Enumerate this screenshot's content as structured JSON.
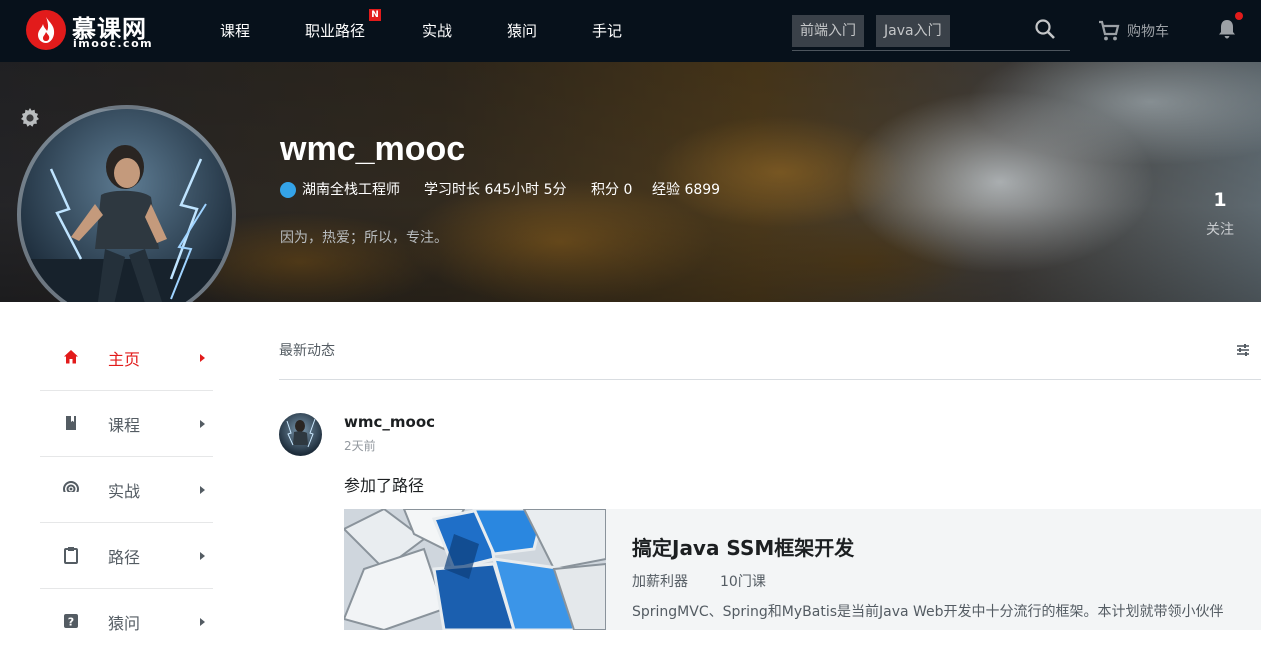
{
  "nav": {
    "logo_cn": "慕课网",
    "logo_en": "imooc.com",
    "items": [
      "课程",
      "职业路径",
      "实战",
      "猿问",
      "手记"
    ],
    "badge": "N",
    "search_tags": [
      "前端入门",
      "Java入门"
    ],
    "cart_label": "购物车"
  },
  "profile": {
    "username": "wmc_mooc",
    "location_title": "湖南全栈工程师",
    "study_time": "学习时长 645小时 5分",
    "points": "积分 0",
    "experience": "经验 6899",
    "signature": "因为，热爱；所以，专注。",
    "follow_count": "1",
    "follow_label": "关注"
  },
  "sidebar": {
    "items": [
      {
        "label": "主页",
        "icon": "home-icon"
      },
      {
        "label": "课程",
        "icon": "book-icon"
      },
      {
        "label": "实战",
        "icon": "target-icon"
      },
      {
        "label": "路径",
        "icon": "clipboard-icon"
      },
      {
        "label": "猿问",
        "icon": "question-icon"
      }
    ]
  },
  "feed": {
    "heading": "最新动态",
    "post": {
      "user": "wmc_mooc",
      "time": "2天前",
      "text": "参加了路径",
      "card": {
        "title": "搞定Java SSM框架开发",
        "tag1": "加薪利器",
        "tag2": "10门课",
        "desc": "SpringMVC、Spring和MyBatis是当前Java Web开发中十分流行的框架。本计划就带领小伙伴"
      }
    }
  },
  "colors": {
    "accent": "#e21b1b",
    "nav_bg": "#07111b"
  }
}
